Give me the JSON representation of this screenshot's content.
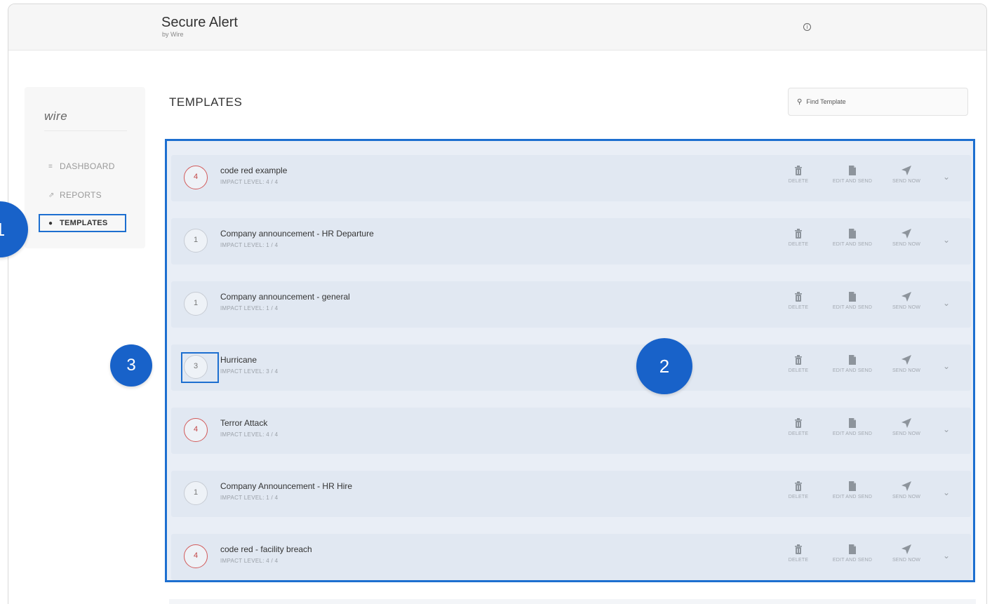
{
  "app": {
    "title": "Secure Alert",
    "subtitle": "by Wire"
  },
  "sidebar": {
    "logo": "wire",
    "items": [
      {
        "label": "DASHBOARD",
        "icon": "list-icon"
      },
      {
        "label": "REPORTS",
        "icon": "chart-icon"
      },
      {
        "label": "TEMPLATES",
        "icon": "dot-icon",
        "active": true
      }
    ]
  },
  "main": {
    "title": "TEMPLATES",
    "search": {
      "placeholder": "Find Template"
    },
    "actions": {
      "delete": "DELETE",
      "edit": "EDIT AND SEND",
      "send": "SEND NOW"
    },
    "templates": [
      {
        "name": "code red example",
        "level": "4",
        "impact": "IMPACT LEVEL: 4 / 4",
        "high": true
      },
      {
        "name": "Company announcement - HR Departure",
        "level": "1",
        "impact": "IMPACT LEVEL: 1 / 4",
        "high": false
      },
      {
        "name": "Company announcement - general",
        "level": "1",
        "impact": "IMPACT LEVEL: 1 / 4",
        "high": false
      },
      {
        "name": "Hurricane",
        "level": "3",
        "impact": "IMPACT LEVEL: 3 / 4",
        "high": false
      },
      {
        "name": "Terror Attack",
        "level": "4",
        "impact": "IMPACT LEVEL: 4 / 4",
        "high": true
      },
      {
        "name": "Company Announcement - HR Hire",
        "level": "1",
        "impact": "IMPACT LEVEL: 1 / 4",
        "high": false
      },
      {
        "name": "code red - facility breach",
        "level": "4",
        "impact": "IMPACT LEVEL: 4 / 4",
        "high": true
      }
    ]
  },
  "callouts": [
    "1",
    "2",
    "3"
  ],
  "colors": {
    "accent": "#1d6fd0",
    "callout": "#1862c9",
    "high_impact": "#d25a5a"
  }
}
